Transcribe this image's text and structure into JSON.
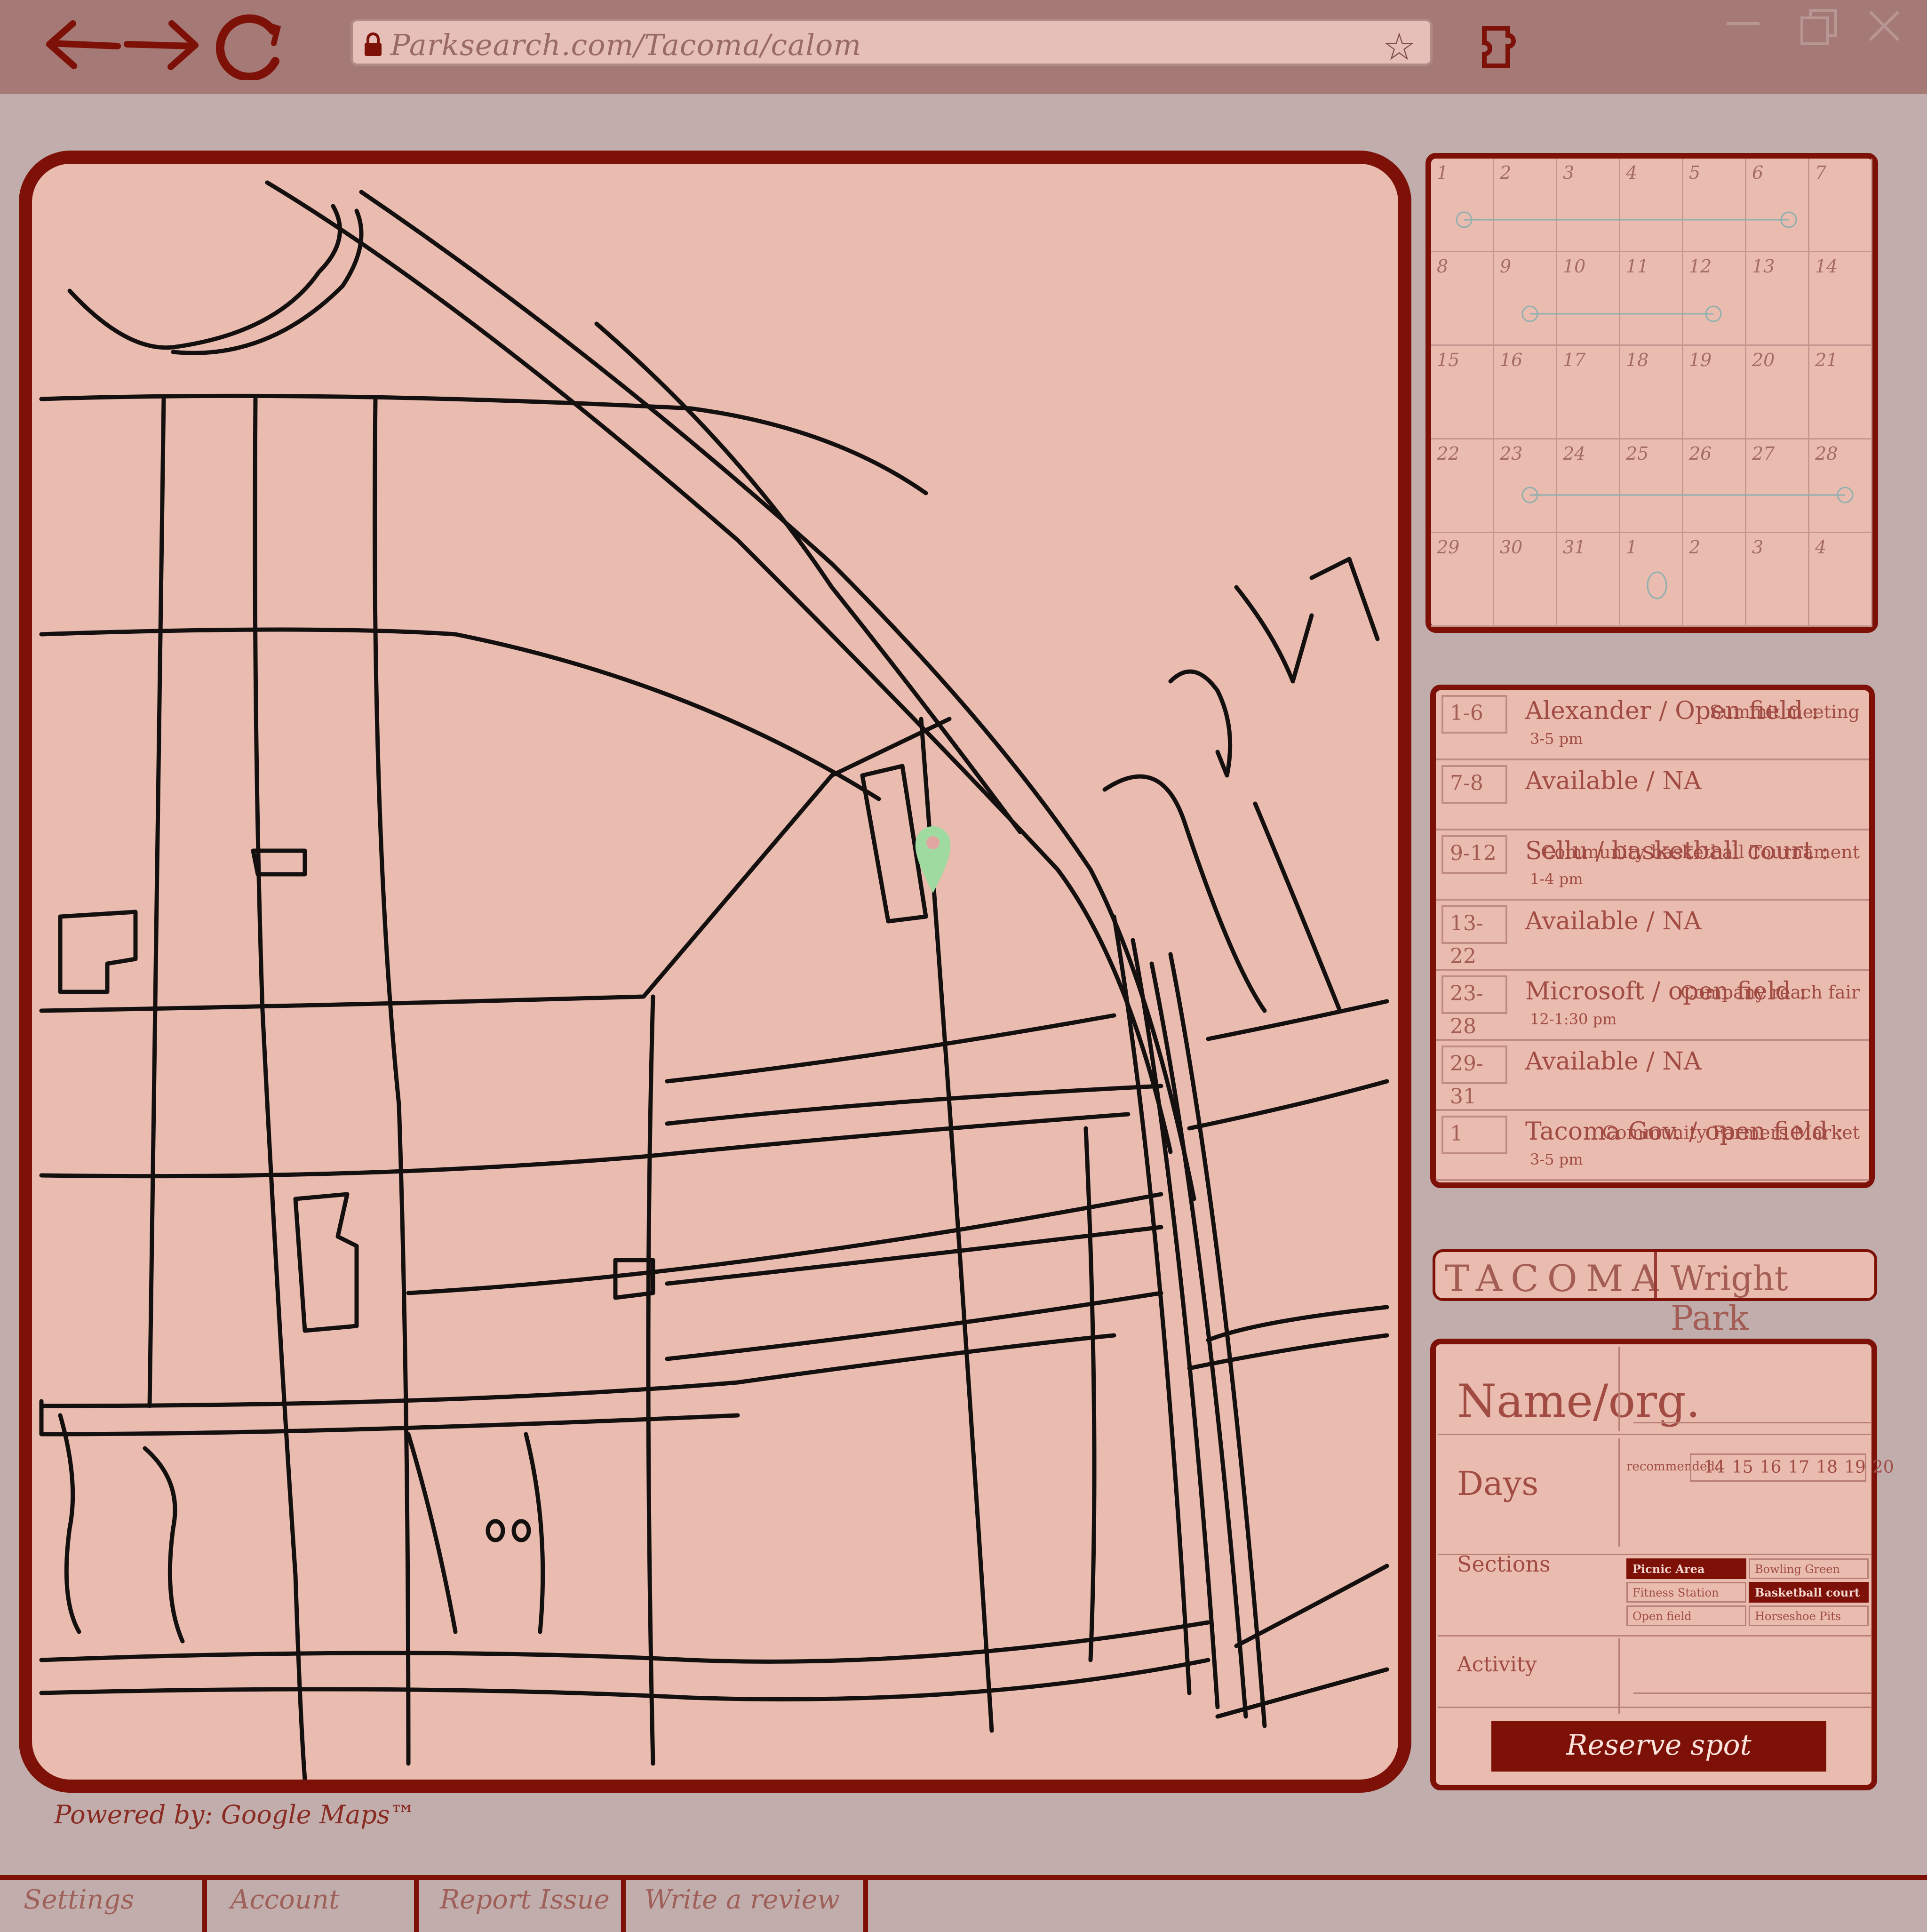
{
  "browser": {
    "url": "Parksearch.com/Tacoma/calom",
    "back_icon": "arrow-left-icon",
    "forward_icon": "arrow-right-icon",
    "reload_icon": "reload-icon",
    "bookmark_glyph": "☆",
    "extension_icon": "puzzle-icon"
  },
  "map": {
    "attribution": "Powered by: Google Maps™",
    "marker_icon": "map-pin-icon"
  },
  "calendar": {
    "weeks": [
      [
        "1",
        "2",
        "3",
        "4",
        "5",
        "6",
        "7"
      ],
      [
        "8",
        "9",
        "10",
        "11",
        "12",
        "13",
        "14"
      ],
      [
        "15",
        "16",
        "17",
        "18",
        "19",
        "20",
        "21"
      ],
      [
        "22",
        "23",
        "24",
        "25",
        "26",
        "27",
        "28"
      ],
      [
        "29",
        "30",
        "31",
        "1",
        "2",
        "3",
        "4"
      ]
    ]
  },
  "schedule": [
    {
      "dates": "1-6",
      "main": "Alexander / Open field :",
      "note": "Summit meeting",
      "time": "3-5 pm"
    },
    {
      "dates": "7-8",
      "main": "Available / NA",
      "note": "",
      "time": ""
    },
    {
      "dates": "9-12",
      "main": "Sellu / basketball court :",
      "note": "Community basketball Tournament",
      "time": "1-4 pm"
    },
    {
      "dates": "13-22",
      "main": "Available / NA",
      "note": "",
      "time": ""
    },
    {
      "dates": "23-28",
      "main": "Microsoft / open field :",
      "note": "Company reach fair",
      "time": "12-1:30 pm"
    },
    {
      "dates": "29-31",
      "main": "Available / NA",
      "note": "",
      "time": ""
    },
    {
      "dates": "1",
      "main": "Tacoma Gov. / open field :",
      "note": "Community Farmers Market",
      "time": "3-5 pm"
    }
  ],
  "location": {
    "city": "TACOMA",
    "park": "Wright Park"
  },
  "form": {
    "name_label": "Name/org.",
    "days_label": "Days",
    "recommended_label": "recommended:",
    "recommended_days": [
      "14",
      "15",
      "16",
      "17",
      "18",
      "19",
      "20"
    ],
    "sections_label": "Sections",
    "sections": [
      {
        "label": "Picnic Area",
        "selected": true
      },
      {
        "label": "Fitness Station",
        "selected": false
      },
      {
        "label": "Open field",
        "selected": false
      },
      {
        "label": "Bowling Green",
        "selected": false
      },
      {
        "label": "Basketball court",
        "selected": true
      },
      {
        "label": "Horseshoe Pits",
        "selected": false
      }
    ],
    "activity_label": "Activity",
    "reserve_label": "Reserve spot"
  },
  "footer": {
    "tabs": [
      "Settings",
      "Account",
      "Report Issue",
      "Write a review"
    ]
  },
  "colors": {
    "accent": "#7d1108",
    "map_fill": "#e9bcaf",
    "marker": "#9fdba0",
    "calendar_event_line": "#8fb0b0"
  }
}
